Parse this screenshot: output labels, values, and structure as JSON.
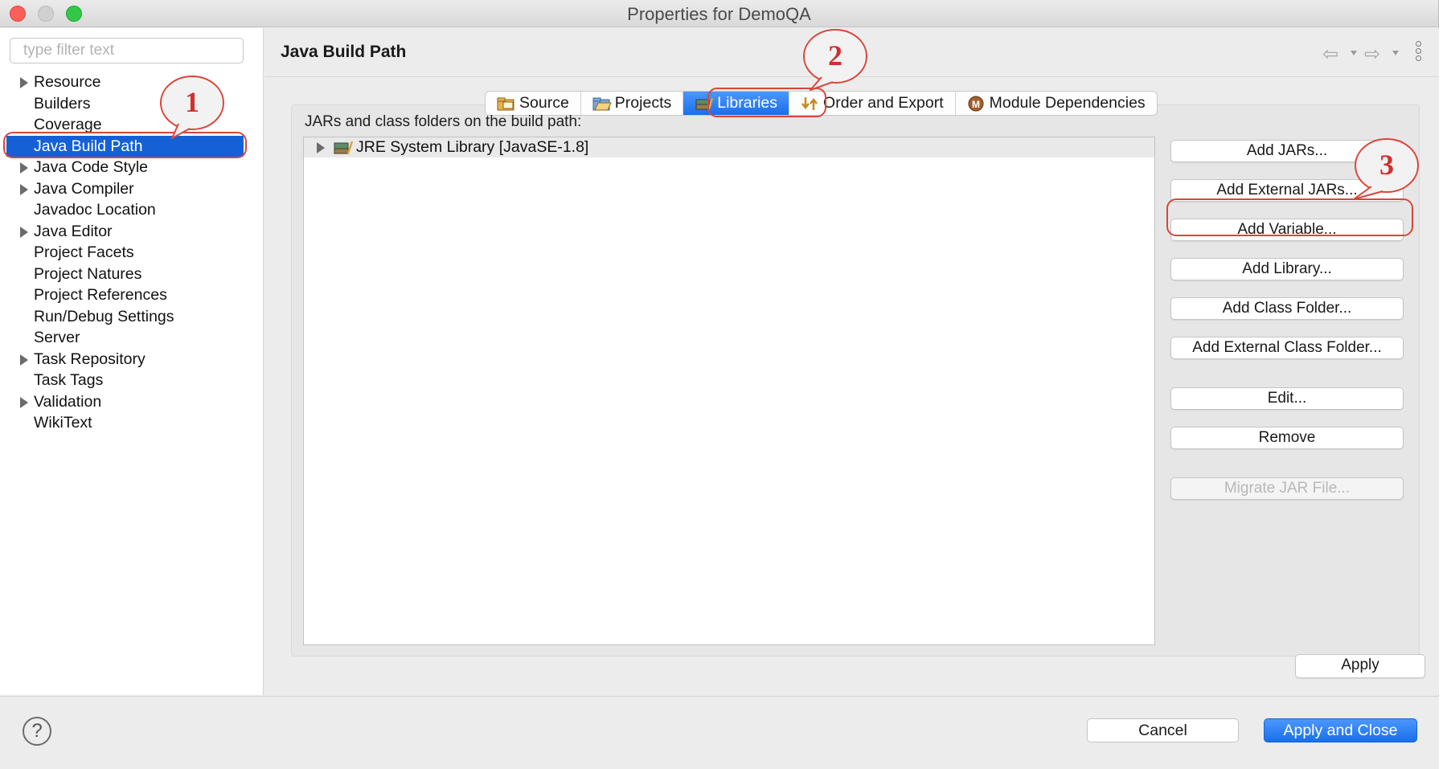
{
  "window": {
    "title": "Properties for DemoQA"
  },
  "sidebar": {
    "filter_placeholder": "type filter text",
    "items": [
      {
        "label": "Resource",
        "expandable": true,
        "selected": false
      },
      {
        "label": "Builders",
        "expandable": false,
        "selected": false
      },
      {
        "label": "Coverage",
        "expandable": false,
        "selected": false
      },
      {
        "label": "Java Build Path",
        "expandable": false,
        "selected": true
      },
      {
        "label": "Java Code Style",
        "expandable": true,
        "selected": false
      },
      {
        "label": "Java Compiler",
        "expandable": true,
        "selected": false
      },
      {
        "label": "Javadoc Location",
        "expandable": false,
        "selected": false
      },
      {
        "label": "Java Editor",
        "expandable": true,
        "selected": false
      },
      {
        "label": "Project Facets",
        "expandable": false,
        "selected": false
      },
      {
        "label": "Project Natures",
        "expandable": false,
        "selected": false
      },
      {
        "label": "Project References",
        "expandable": false,
        "selected": false
      },
      {
        "label": "Run/Debug Settings",
        "expandable": false,
        "selected": false
      },
      {
        "label": "Server",
        "expandable": false,
        "selected": false
      },
      {
        "label": "Task Repository",
        "expandable": true,
        "selected": false
      },
      {
        "label": "Task Tags",
        "expandable": false,
        "selected": false
      },
      {
        "label": "Validation",
        "expandable": true,
        "selected": false
      },
      {
        "label": "WikiText",
        "expandable": false,
        "selected": false
      }
    ]
  },
  "main": {
    "page_title": "Java Build Path",
    "tabs": [
      {
        "label": "Source",
        "icon": "source-folder-icon",
        "active": false
      },
      {
        "label": "Projects",
        "icon": "projects-folder-icon",
        "active": false
      },
      {
        "label": "Libraries",
        "icon": "libraries-icon",
        "active": true
      },
      {
        "label": "Order and Export",
        "icon": "order-export-icon",
        "active": false
      },
      {
        "label": "Module Dependencies",
        "icon": "module-icon",
        "active": false
      }
    ],
    "build_path_label": "JARs and class folders on the build path:",
    "libraries": [
      {
        "label": "JRE System Library [JavaSE-1.8]",
        "icon": "library-icon"
      }
    ],
    "buttons": [
      {
        "label": "Add JARs...",
        "enabled": true
      },
      {
        "label": "Add External JARs...",
        "enabled": true
      },
      {
        "label": "Add Variable...",
        "enabled": true
      },
      {
        "label": "Add Library...",
        "enabled": true
      },
      {
        "label": "Add Class Folder...",
        "enabled": true
      },
      {
        "label": "Add External Class Folder...",
        "enabled": true
      },
      {
        "label": "Edit...",
        "enabled": true
      },
      {
        "label": "Remove",
        "enabled": true
      },
      {
        "label": "Migrate JAR File...",
        "enabled": false
      }
    ],
    "apply_label": "Apply"
  },
  "footer": {
    "help_label": "?",
    "cancel_label": "Cancel",
    "apply_close_label": "Apply and Close"
  },
  "annotations": [
    {
      "number": "1"
    },
    {
      "number": "2"
    },
    {
      "number": "3"
    }
  ],
  "colors": {
    "selection": "#1660d6",
    "accent_button": "#1a6fe9",
    "annotation": "#d32f2f"
  }
}
